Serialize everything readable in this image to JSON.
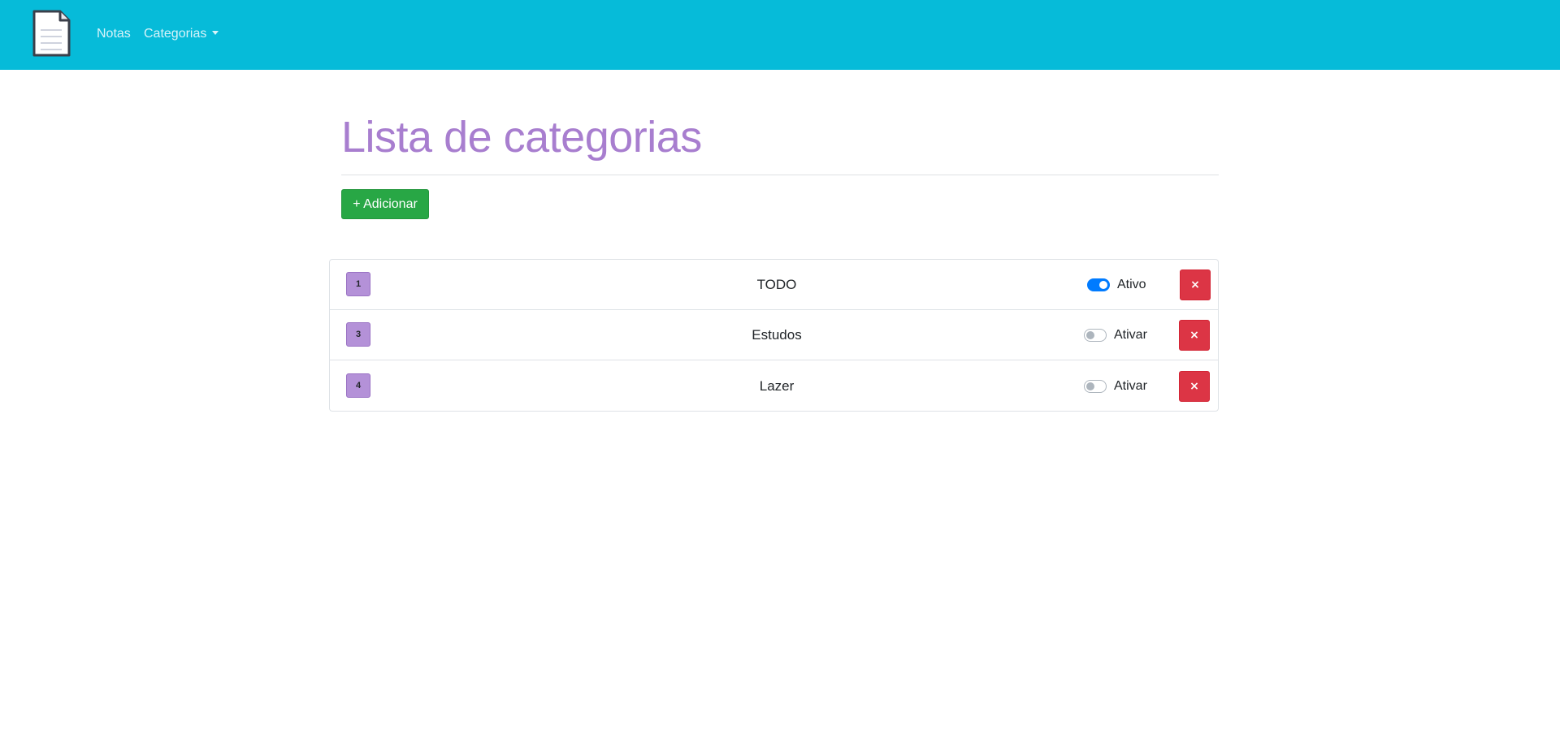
{
  "navbar": {
    "background": "#06bbd9",
    "brand_icon": "document-icon",
    "links": [
      {
        "label": "Notas"
      },
      {
        "label": "Categorias",
        "has_dropdown": true
      }
    ]
  },
  "header": {
    "title": "Lista de categorias",
    "title_color": "#a87ecf"
  },
  "toolbar": {
    "add_label": "+ Adicionar",
    "add_color": "#28a745"
  },
  "categories": [
    {
      "id": "1",
      "name": "TODO",
      "active": true,
      "toggle_label": "Ativo",
      "delete_label": "×"
    },
    {
      "id": "3",
      "name": "Estudos",
      "active": false,
      "toggle_label": "Ativar",
      "delete_label": "×"
    },
    {
      "id": "4",
      "name": "Lazer",
      "active": false,
      "toggle_label": "Ativar",
      "delete_label": "×"
    }
  ],
  "colors": {
    "badge": "#b491d8",
    "toggle_on": "#007bff",
    "delete": "#dc3545"
  }
}
